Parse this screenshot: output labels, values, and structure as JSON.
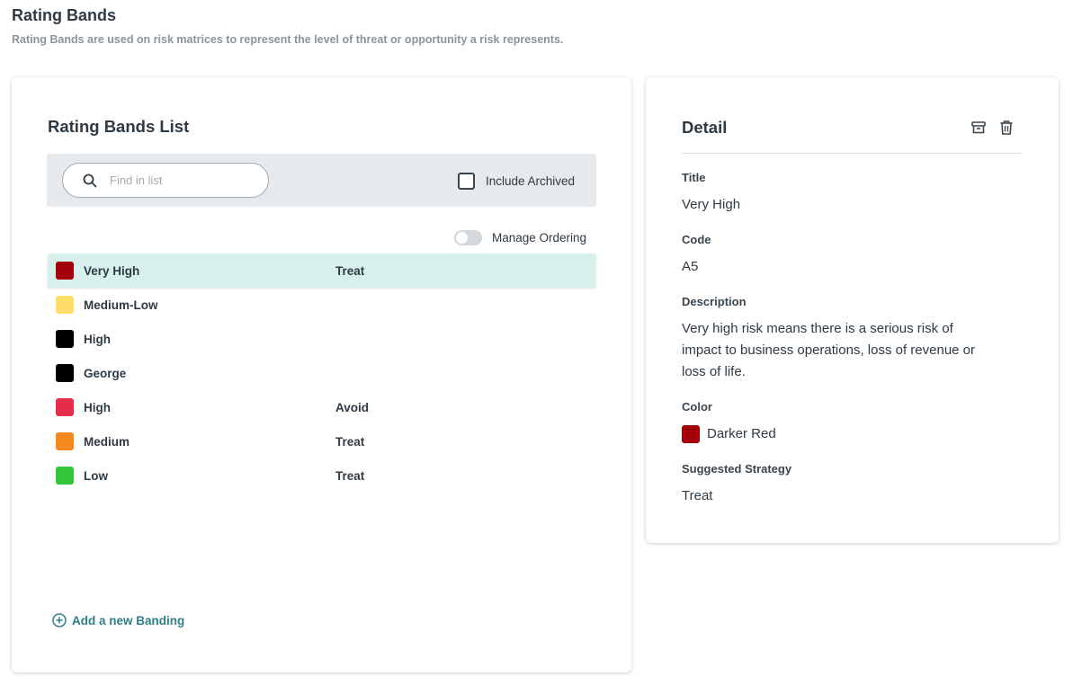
{
  "header": {
    "title": "Rating Bands",
    "subtitle": "Rating Bands are used on risk matrices to represent the level of threat or opportunity a risk represents."
  },
  "list": {
    "title": "Rating Bands List",
    "search_placeholder": "Find in list",
    "search_value": "",
    "include_archived_label": "Include Archived",
    "include_archived_checked": false,
    "manage_ordering_label": "Manage Ordering",
    "manage_ordering_on": false,
    "add_label": "Add a new Banding",
    "items": [
      {
        "name": "Very High",
        "strategy": "Treat",
        "color": "#a3000b",
        "selected": true
      },
      {
        "name": "Medium-Low",
        "strategy": "",
        "color": "#ffdd66",
        "selected": false
      },
      {
        "name": "High",
        "strategy": "",
        "color": "#000000",
        "selected": false
      },
      {
        "name": "George",
        "strategy": "",
        "color": "#000000",
        "selected": false
      },
      {
        "name": "High",
        "strategy": "Avoid",
        "color": "#e52d4a",
        "selected": false
      },
      {
        "name": "Medium",
        "strategy": "Treat",
        "color": "#f5891e",
        "selected": false
      },
      {
        "name": "Low",
        "strategy": "Treat",
        "color": "#33c639",
        "selected": false
      }
    ]
  },
  "detail": {
    "title": "Detail",
    "icons": [
      "archive-icon",
      "trash-icon"
    ],
    "title_label": "Title",
    "title_value": "Very High",
    "code_label": "Code",
    "code_value": "A5",
    "description_label": "Description",
    "description_value": "Very high risk means there is a serious risk of impact to business operations, loss of revenue or loss of life.",
    "color_label": "Color",
    "color_value": "Darker Red",
    "color_hex": "#a3000b",
    "strategy_label": "Suggested Strategy",
    "strategy_value": "Treat"
  },
  "colors": {
    "accent": "#2f7f86",
    "selected_row": "#d7f0ec",
    "search_bar_bg": "#e7eaec"
  }
}
